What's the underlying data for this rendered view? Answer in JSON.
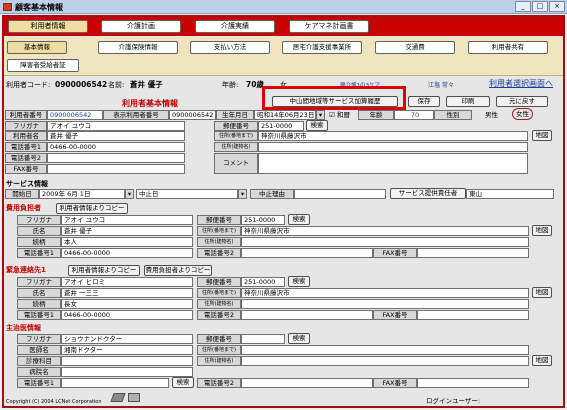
{
  "window": {
    "title": "顧客基本情報",
    "controls": [
      "_",
      "□",
      "×"
    ]
  },
  "main_tabs": [
    {
      "label": "利用者情報",
      "selected": true
    },
    {
      "label": "介護計画",
      "selected": false
    },
    {
      "label": "介護実績",
      "selected": false
    },
    {
      "label": "ケアマネ計画書",
      "selected": false
    }
  ],
  "sub_tabs": [
    {
      "label": "基本情報",
      "selected": true
    },
    {
      "label": "介護保険情報",
      "selected": false
    },
    {
      "label": "支払い方法",
      "selected": false
    },
    {
      "label": "居宅介護支援事業所",
      "selected": false
    },
    {
      "label": "交通費",
      "selected": false
    },
    {
      "label": "利用者共有",
      "selected": false
    },
    {
      "label": "障害者受給者証",
      "selected": false
    }
  ],
  "header": {
    "code_label": "利用者コード:",
    "code_value": "0900006542",
    "name_label": "名前:",
    "name_value": "蒼井 優子",
    "age_label": "年齢:",
    "age_value": "70歳",
    "gender": "女",
    "care_note": "要介護1の3ケア",
    "staff_label": "江塩 常々",
    "select_link": "利用者選択画面へ"
  },
  "panel_title": "利用者基本情報",
  "toolbar": {
    "history": "中山間地域等サービス加算履歴",
    "save": "保存",
    "print": "印刷",
    "back": "元に戻す"
  },
  "basic": {
    "user_no_label": "利用者番号",
    "user_no": "0900006542",
    "display_no_label": "表示利用者番号",
    "display_no": "0900006542",
    "birth_label": "生年月日",
    "birth_value": "昭和14年06月23日",
    "era": "和暦",
    "age_label": "年齢",
    "age": "70",
    "gender_label": "性別",
    "male": "男性",
    "female": "女性",
    "furigana_label": "フリガナ",
    "furigana": "アオイ ユウコ",
    "name_label": "利用者名",
    "name": "蒼井 優子",
    "tel1_label": "電話番号1",
    "tel1": "0466-00-0000",
    "tel2_label": "電話番号2",
    "tel2": "",
    "fax_label": "FAX番号",
    "fax": "",
    "zip_label": "郵便番号",
    "zip": "251-0000",
    "search": "検索",
    "addr1_label": "住所(番地まで)",
    "addr1": "神奈川県藤沢市",
    "addr2_label": "住所(建物名)",
    "addr2": "",
    "comment_label": "コメント",
    "map": "地図"
  },
  "service": {
    "section": "サービス情報",
    "start_label": "開始日",
    "start_value": "2009年 6月 1日",
    "stop_label": "中止日",
    "stop_reason_label": "中止理由",
    "manager_label": "サービス提供責任者",
    "manager_value": "東山"
  },
  "payer": {
    "section": "費用負担者",
    "copy_btn": "利用者情報よりコピー",
    "furigana_label": "フリガナ",
    "furigana": "アオイ ユウコ",
    "name_label": "氏名",
    "name": "蒼井 優子",
    "rel_label": "続柄",
    "rel": "本人",
    "tel1_label": "電話番号1",
    "tel1": "0466-00-0000",
    "zip_label": "郵便番号",
    "zip": "251-0000",
    "search": "検索",
    "addr1_label": "住所(番地まで)",
    "addr1": "神奈川県藤沢市",
    "addr2_label": "住所(建物名)",
    "addr2": "",
    "tel2_label": "電話番号2",
    "tel2": "",
    "fax_label": "FAX番号",
    "fax": "",
    "map": "地図"
  },
  "emergency": {
    "section": "緊急連絡先1",
    "copy_btn": "利用者情報よりコピー",
    "copy_btn2": "費用負担者よりコピー",
    "furigana_label": "フリガナ",
    "furigana": "アオイ ヒロミ",
    "name_label": "氏名",
    "name": "蒼井 一三三",
    "rel_label": "続柄",
    "rel": "長女",
    "tel1_label": "電話番号1",
    "tel1": "0466-00-0000",
    "zip_label": "郵便番号",
    "zip": "251-0000",
    "search": "検索",
    "addr1_label": "住所(番地まで)",
    "addr1": "神奈川県藤沢市",
    "addr2_label": "住所(建物名)",
    "addr2": "",
    "tel2_label": "電話番号2",
    "tel2": "",
    "fax_label": "FAX番号",
    "fax": "",
    "map": "地図"
  },
  "doctor": {
    "section": "主治医情報",
    "furigana_label": "フリガナ",
    "furigana": "ショウナンドクター",
    "name_label": "医師名",
    "name": "湘南ドクター",
    "dept_label": "診療科目",
    "dept": "",
    "hospital_label": "病院名",
    "hospital": "",
    "tel1_label": "電話番号1",
    "tel1": "",
    "search_btn": "検索",
    "zip_label": "郵便番号",
    "zip": "",
    "search": "検索",
    "addr1_label": "住所(番地まで)",
    "addr1": "",
    "addr2_label": "住所(建物名)",
    "addr2": "",
    "tel2_label": "電話番号2",
    "tel2": "",
    "fax_label": "FAX番号",
    "fax": "",
    "map": "地図"
  },
  "footer": {
    "copyright": "Copyright (C) 2004 LCNet Corporation",
    "login_label": "ログインユーザー:"
  }
}
